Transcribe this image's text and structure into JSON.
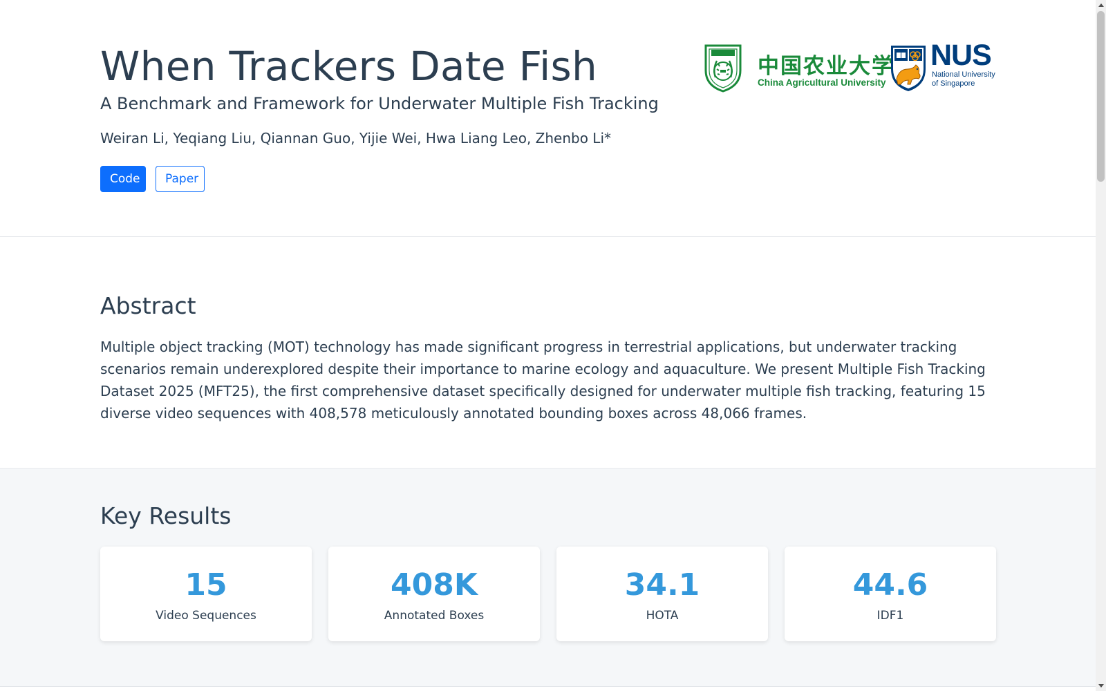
{
  "header": {
    "title": "When Trackers Date Fish",
    "subtitle": "A Benchmark and Framework for Underwater Multiple Fish Tracking",
    "authors": "Weiran Li, Yeqiang Liu, Qiannan Guo, Yijie Wei, Hwa Liang Leo, Zhenbo Li*",
    "buttons": {
      "code": "Code",
      "paper": "Paper"
    },
    "logos": {
      "cau_chinese": "中国农业大学",
      "cau_english": "China Agricultural University",
      "nus_short": "NUS",
      "nus_full_line1": "National University",
      "nus_full_line2": "of Singapore",
      "cau_color": "#1a8a3a",
      "nus_color": "#003d7c",
      "nus_accent": "#f39c12"
    }
  },
  "abstract": {
    "heading": "Abstract",
    "text": "Multiple object tracking (MOT) technology has made significant progress in terrestrial applications, but underwater tracking scenarios remain underexplored despite their importance to marine ecology and aquaculture. We present Multiple Fish Tracking Dataset 2025 (MFT25), the first comprehensive dataset specifically designed for underwater multiple fish tracking, featuring 15 diverse video sequences with 408,578 meticulously annotated bounding boxes across 48,066 frames."
  },
  "results": {
    "heading": "Key Results",
    "cards": [
      {
        "value": "15",
        "label": "Video Sequences"
      },
      {
        "value": "408K",
        "label": "Annotated Boxes"
      },
      {
        "value": "34.1",
        "label": "HOTA"
      },
      {
        "value": "44.6",
        "label": "IDF1"
      }
    ]
  },
  "colors": {
    "primary": "#0d6efd",
    "accent": "#3498db",
    "text": "#2c3e50"
  },
  "scrollbar": {
    "position": 0.0
  }
}
